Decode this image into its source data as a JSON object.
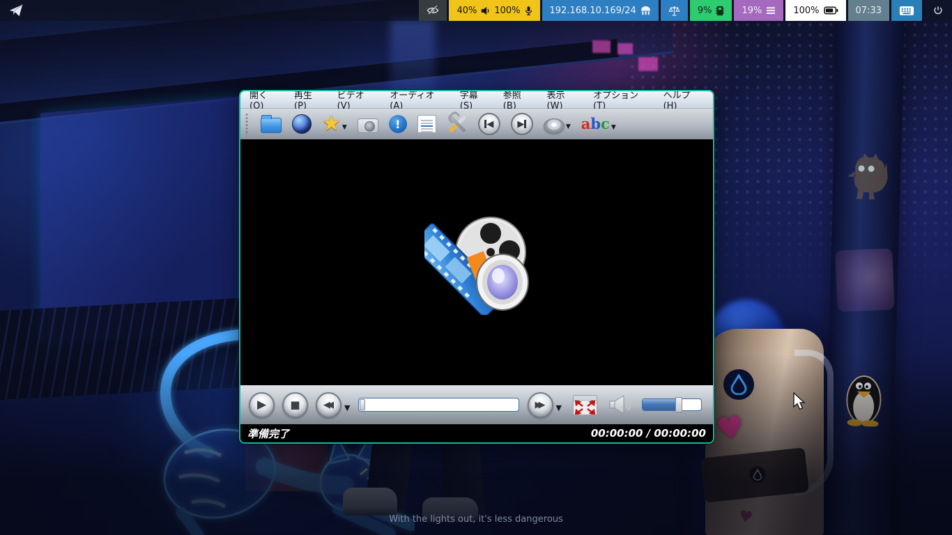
{
  "topbar": {
    "audio": {
      "volume": "40%",
      "mic_level": "100%"
    },
    "network": {
      "ip": "192.168.10.169/24"
    },
    "cpu": {
      "value": "9%"
    },
    "memory": {
      "value": "19%"
    },
    "battery": {
      "value": "100%"
    },
    "clock": {
      "value": "07:33"
    }
  },
  "colors": {
    "audio_bg": "#f0c419",
    "network_bg": "#2e7fc1",
    "cpu_bg": "#2ecc71",
    "memory_bg": "#a569bd",
    "battery_bg": "#ffffff",
    "clock_bg": "#64808e",
    "keyboard_bg": "#2980b9",
    "window_border": "#14b8a6",
    "seek_border": "#3a6ea5"
  },
  "player": {
    "menu": {
      "items": [
        {
          "pre": "開く(",
          "key": "O",
          "post": ")"
        },
        {
          "pre": "再生(",
          "key": "P",
          "post": ")"
        },
        {
          "pre": "ビデオ(",
          "key": "V",
          "post": ")"
        },
        {
          "pre": "オーディオ(",
          "key": "A",
          "post": ")"
        },
        {
          "pre": "字幕(",
          "key": "S",
          "post": ")"
        },
        {
          "pre": "参照(",
          "key": "B",
          "post": ")"
        },
        {
          "pre": "表示(",
          "key": "W",
          "post": ")"
        },
        {
          "pre": "オプション(",
          "key": "T",
          "post": ")"
        },
        {
          "pre": "ヘルプ(",
          "key": "H",
          "post": ")"
        }
      ]
    },
    "toolbar": {
      "info_glyph": "!",
      "subtitle_letters": {
        "s1": "a",
        "s2": "b",
        "s3": "c"
      }
    },
    "controls": {
      "play_glyph": "▶",
      "stop_glyph": "■",
      "rewind_glyph": "◀◀",
      "forward_glyph": "▶▶",
      "volume_percent": "62"
    },
    "statusbar": {
      "status": "準備完了",
      "time": "00:00:00 / 00:00:00"
    }
  },
  "desktop": {
    "caption": "With the lights out, it's less dangerous"
  }
}
